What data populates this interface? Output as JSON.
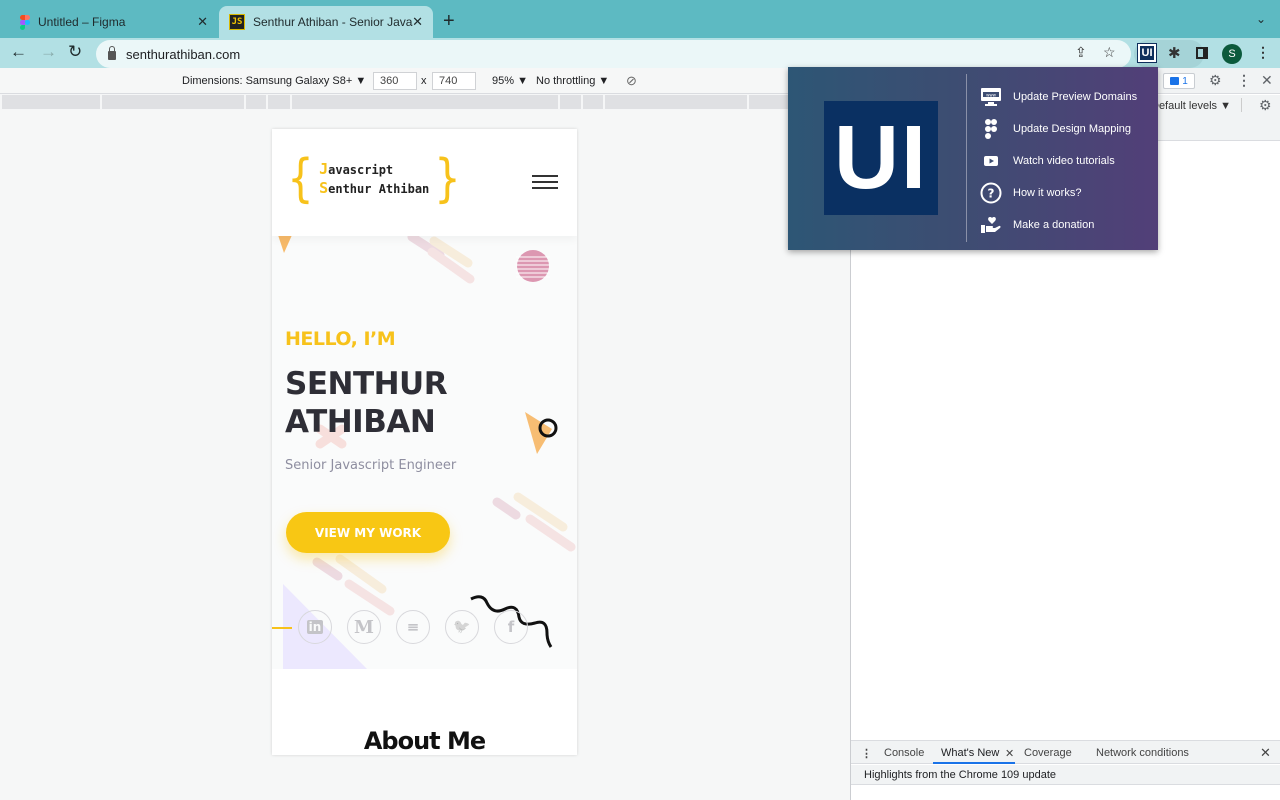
{
  "browser": {
    "tabs": [
      {
        "title": "Untitled – Figma",
        "icon": "figma-icon",
        "active": false
      },
      {
        "title": "Senthur Athiban - Senior Javascript",
        "icon": "js-favicon-icon",
        "active": true
      }
    ],
    "new_tab_label": "+",
    "url": "senthurathiban.com",
    "profile_initial": "S",
    "extension_label": "UI"
  },
  "device_toolbar": {
    "dimensions_label": "Dimensions: Samsung Galaxy S8+ ▼",
    "width": "360",
    "times": "x",
    "height": "740",
    "zoom": "95% ▼",
    "throttling": "No throttling ▼"
  },
  "site": {
    "logo": {
      "line1_cap": "J",
      "line1_rest": "avascript",
      "line2_cap": "S",
      "line2_rest": "enthur Athiban",
      "brace_open": "{",
      "brace_close": "}"
    },
    "hero": {
      "greeting": "HELLO, I’M",
      "name_line1": "SENTHUR",
      "name_line2": "ATHIBAN",
      "role": "Senior Javascript Engineer",
      "cta": "VIEW MY WORK"
    },
    "socials": [
      {
        "name": "linkedin",
        "glyph": "in"
      },
      {
        "name": "medium",
        "glyph": "M"
      },
      {
        "name": "stackoverflow",
        "glyph": "≡"
      },
      {
        "name": "twitter",
        "glyph": "🐦"
      },
      {
        "name": "facebook",
        "glyph": "f"
      }
    ],
    "about_heading": "About Me",
    "accent_color": "#f7c21b"
  },
  "popup": {
    "logo_text": "UI",
    "items": [
      {
        "label": "Update Preview Domains",
        "icon": "monitor-www-icon"
      },
      {
        "label": "Update Design Mapping",
        "icon": "figma-icon"
      },
      {
        "label": "Watch video tutorials",
        "icon": "youtube-icon"
      },
      {
        "label": "How it works?",
        "icon": "help-circle-icon"
      },
      {
        "label": "Make a donation",
        "icon": "donation-hand-icon"
      }
    ]
  },
  "devtools": {
    "issues_count": "1",
    "levels_label": "Default levels ▼",
    "drawer_tabs": [
      "Console",
      "What's New",
      "Coverage",
      "Network conditions"
    ],
    "active_drawer_tab": "What's New",
    "drawer_subtitle": "Highlights from the Chrome 109 update"
  }
}
